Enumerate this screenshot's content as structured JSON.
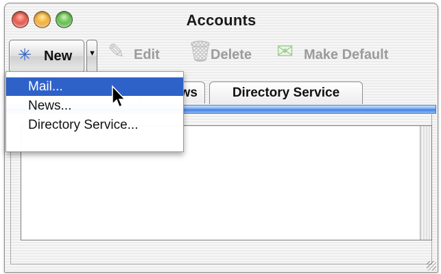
{
  "window": {
    "title": "Accounts"
  },
  "toolbar": {
    "new_label": "New",
    "edit_label": "Edit",
    "delete_label": "Delete",
    "make_default_label": "Make Default"
  },
  "tabs": [
    {
      "label": "ws"
    },
    {
      "label": "Directory Service"
    }
  ],
  "menu": {
    "items": [
      {
        "label": "Mail..."
      },
      {
        "label": "News..."
      },
      {
        "label": "Directory Service..."
      }
    ]
  }
}
